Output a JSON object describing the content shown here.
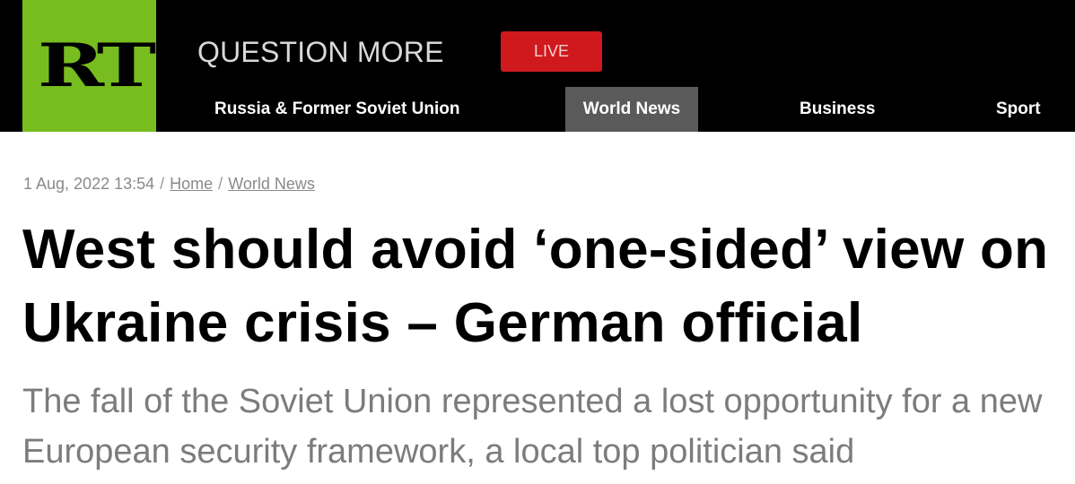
{
  "header": {
    "logo_text": "RT",
    "tagline": "QUESTION MORE",
    "live_label": "LIVE",
    "colors": {
      "logo_background": "#77bd1f",
      "bar_background": "#000000",
      "live_background": "#d0191d",
      "active_nav_background": "#5a5a5a"
    }
  },
  "nav": {
    "items": [
      {
        "label": "Russia & Former Soviet Union",
        "active": false
      },
      {
        "label": "World News",
        "active": true
      },
      {
        "label": "Business",
        "active": false
      },
      {
        "label": "Sport",
        "active": false
      }
    ]
  },
  "article": {
    "breadcrumb": {
      "date": "1 Aug, 2022 13:54",
      "separator": "/",
      "home": "Home",
      "section": "World News"
    },
    "headline": "West should avoid ‘one-sided’ view on Ukraine crisis – German official",
    "summary": "The fall of the Soviet Union represented a lost opportunity for a new European security framework, a local top politician said"
  }
}
